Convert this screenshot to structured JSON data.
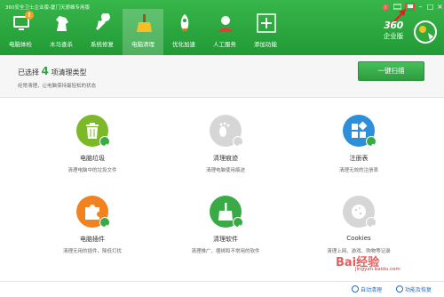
{
  "window": {
    "title": "360安全卫士企业版-厦门天骄维专用版",
    "controls": [
      "feedback-icon",
      "menu-icon",
      "skin-icon",
      "minimize-icon",
      "maximize-icon",
      "close-icon"
    ]
  },
  "nav": {
    "items": [
      {
        "label": "电脑体检",
        "icon": "monitor-icon",
        "badge": "!"
      },
      {
        "label": "木马查杀",
        "icon": "horse-icon"
      },
      {
        "label": "系统修复",
        "icon": "wrench-icon"
      },
      {
        "label": "电脑清理",
        "icon": "broom-icon",
        "active": true
      },
      {
        "label": "优化加速",
        "icon": "rocket-icon"
      },
      {
        "label": "人工服务",
        "icon": "support-icon"
      },
      {
        "label": "添加功能",
        "icon": "plus-icon"
      }
    ]
  },
  "brand": {
    "top": "360",
    "bottom": "企业版"
  },
  "header": {
    "prefix": "已选择",
    "count": "4",
    "suffix": "项清理类型",
    "subtitle": "经常清理，让电脑保持最轻松的状态",
    "scan_button": "一键扫描"
  },
  "cards": [
    {
      "title": "电脑垃圾",
      "desc": "清理电脑中的垃圾文件",
      "icon": "trash-icon",
      "checked": true
    },
    {
      "title": "清理痕迹",
      "desc": "清理电脑使用痕迹",
      "icon": "footprint-icon",
      "checked": false
    },
    {
      "title": "注册表",
      "desc": "清理无效的注册表",
      "icon": "registry-icon",
      "checked": true
    },
    {
      "title": "电脑插件",
      "desc": "清理无用的插件，降低打扰",
      "icon": "puzzle-icon",
      "checked": true
    },
    {
      "title": "清理软件",
      "desc": "清理推广、捆绑和不常用的软件",
      "icon": "broom-icon",
      "checked": true
    },
    {
      "title": "Cookies",
      "desc": "清理上网、游戏、购物等记录",
      "icon": "cookie-icon",
      "checked": false
    }
  ],
  "footer": {
    "auto_clean": "自动清理",
    "restore": "功能及恢复"
  },
  "watermark": {
    "text": "Bai经验",
    "sub": "jingyan.baidu.com"
  },
  "colors": {
    "brand_green": "#2fa83e",
    "blue_accent": "#1a6fc8"
  }
}
